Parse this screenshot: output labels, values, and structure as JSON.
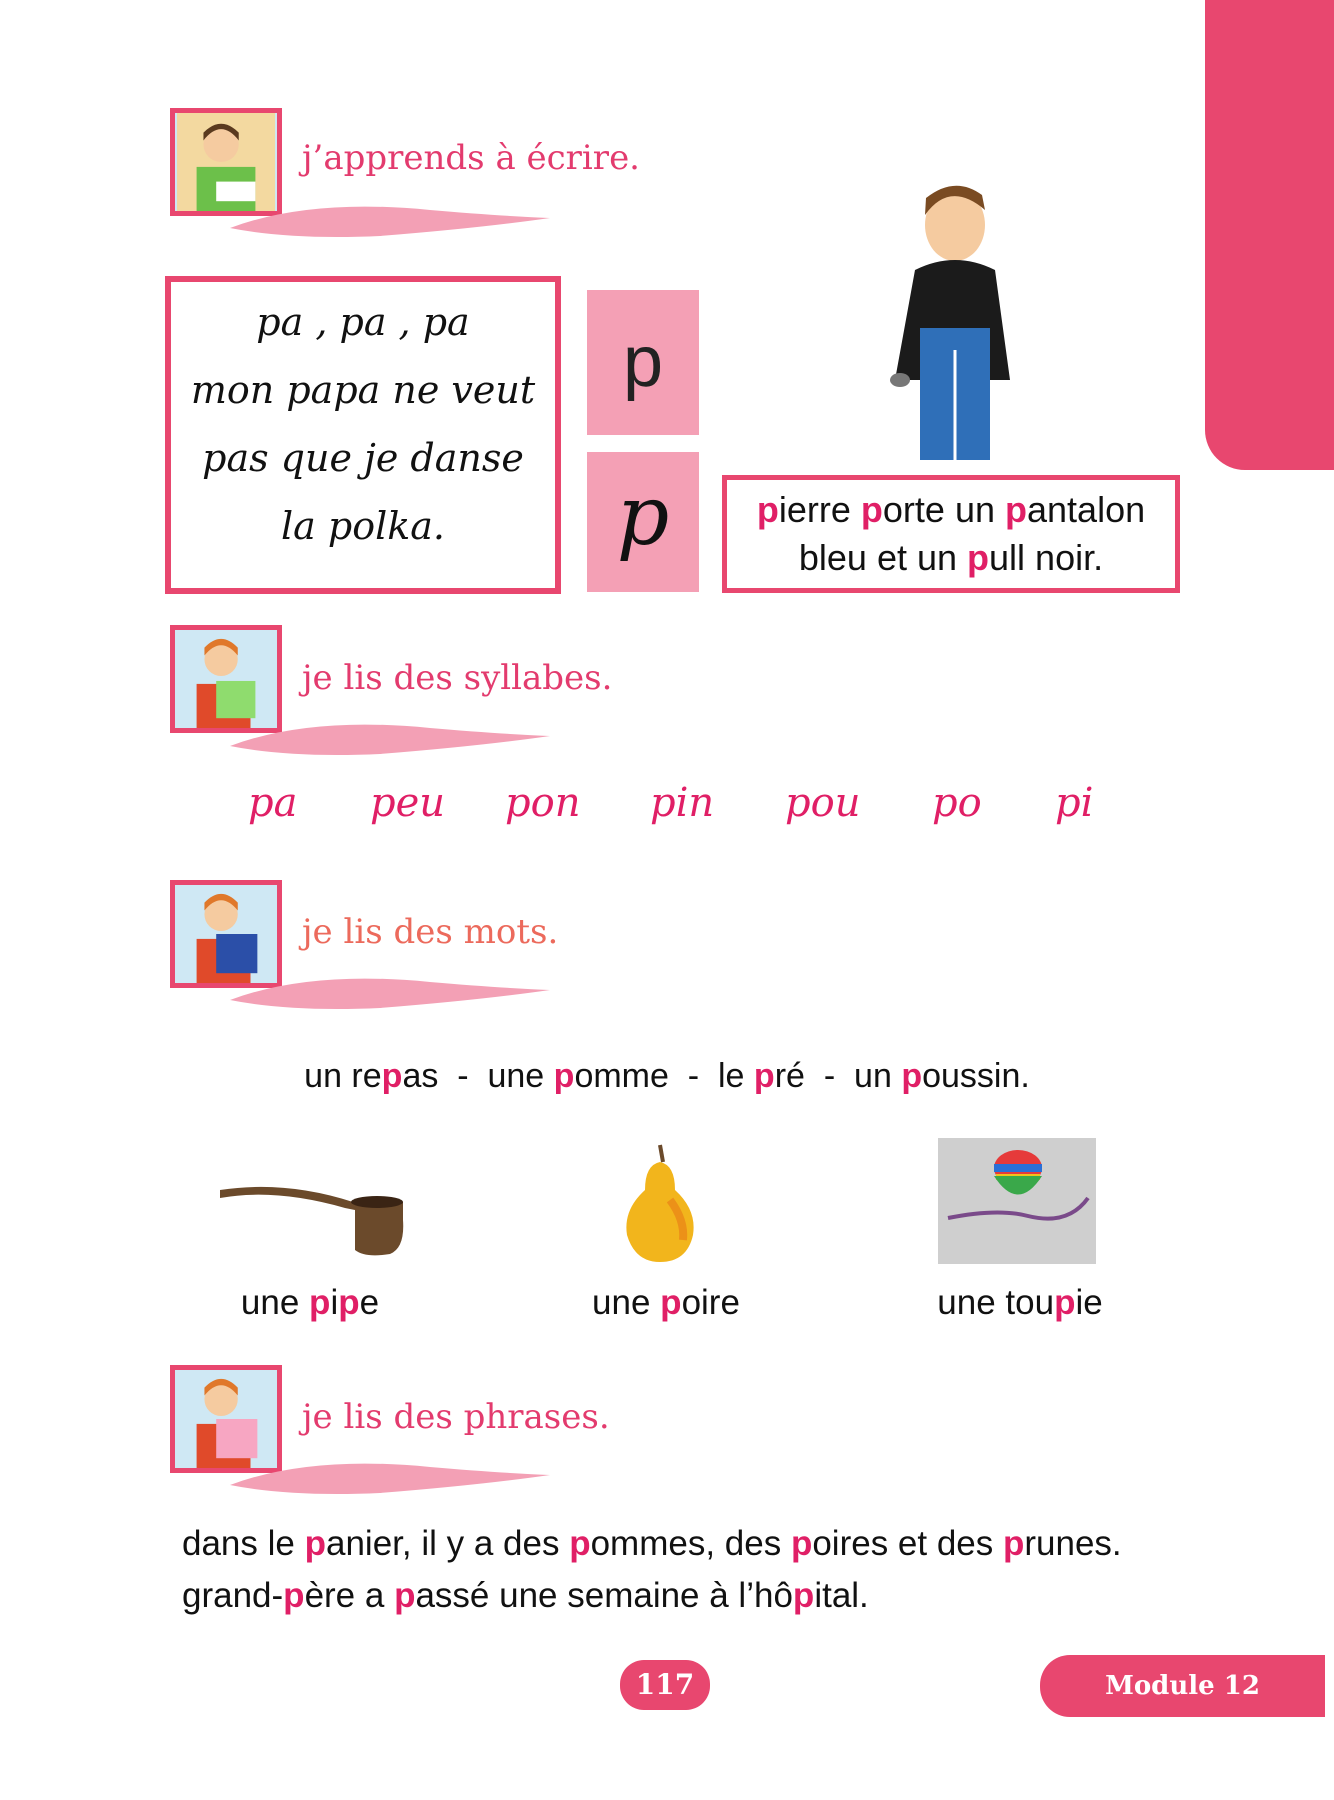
{
  "sections": {
    "writing": {
      "title": "j’apprends à écrire."
    },
    "syllables": {
      "title": "je lis des syllabes."
    },
    "words": {
      "title": "je lis des mots."
    },
    "phrases": {
      "title": "je lis des phrases."
    }
  },
  "cursive_box": {
    "lines": [
      "pa , pa , pa",
      "mon papa ne veut",
      "pas que je danse",
      "la polka."
    ]
  },
  "letter": {
    "print": "p",
    "script": "p"
  },
  "sentence": {
    "line1": [
      {
        "t": "p",
        "hl": true
      },
      {
        "t": "ierre ",
        "hl": false
      },
      {
        "t": "p",
        "hl": true
      },
      {
        "t": "orte un ",
        "hl": false
      },
      {
        "t": "p",
        "hl": true
      },
      {
        "t": "antalon",
        "hl": false
      }
    ],
    "line2": [
      {
        "t": "bleu et un ",
        "hl": false
      },
      {
        "t": "p",
        "hl": true
      },
      {
        "t": "ull noir.",
        "hl": false
      }
    ]
  },
  "syllables": [
    "pa",
    "peu",
    "pon",
    "pin",
    "pou",
    "po",
    "pi"
  ],
  "words_line": [
    {
      "t": "un re",
      "hl": false
    },
    {
      "t": "p",
      "hl": true
    },
    {
      "t": "as  -  une ",
      "hl": false
    },
    {
      "t": "p",
      "hl": true
    },
    {
      "t": "omme  -  le ",
      "hl": false
    },
    {
      "t": "p",
      "hl": true
    },
    {
      "t": "ré  -  un ",
      "hl": false
    },
    {
      "t": "p",
      "hl": true
    },
    {
      "t": "oussin.",
      "hl": false
    }
  ],
  "pictures": [
    {
      "name": "pipe",
      "caption": [
        {
          "t": "une ",
          "hl": false
        },
        {
          "t": "p",
          "hl": true
        },
        {
          "t": "i",
          "hl": false
        },
        {
          "t": "p",
          "hl": true
        },
        {
          "t": "e",
          "hl": false
        }
      ]
    },
    {
      "name": "poire",
      "caption": [
        {
          "t": "une ",
          "hl": false
        },
        {
          "t": "p",
          "hl": true
        },
        {
          "t": "oire",
          "hl": false
        }
      ]
    },
    {
      "name": "toupie",
      "caption": [
        {
          "t": "une tou",
          "hl": false
        },
        {
          "t": "p",
          "hl": true
        },
        {
          "t": "ie",
          "hl": false
        }
      ]
    }
  ],
  "phrases": [
    [
      {
        "t": "dans le ",
        "hl": false
      },
      {
        "t": "p",
        "hl": true
      },
      {
        "t": "anier, il y a des ",
        "hl": false
      },
      {
        "t": "p",
        "hl": true
      },
      {
        "t": "ommes, des ",
        "hl": false
      },
      {
        "t": "p",
        "hl": true
      },
      {
        "t": "oires et des ",
        "hl": false
      },
      {
        "t": "p",
        "hl": true
      },
      {
        "t": "runes.",
        "hl": false
      }
    ],
    [
      {
        "t": "grand-",
        "hl": false
      },
      {
        "t": "p",
        "hl": true
      },
      {
        "t": "ère a ",
        "hl": false
      },
      {
        "t": "p",
        "hl": true
      },
      {
        "t": "assé une semaine à l’hô",
        "hl": false
      },
      {
        "t": "p",
        "hl": true
      },
      {
        "t": "ital.",
        "hl": false
      }
    ]
  ],
  "footer": {
    "page_number": "117",
    "module": "Module 12"
  },
  "colors": {
    "accent": "#e8476f",
    "highlight": "#e01f66",
    "letter_bg": "#f4a0b5"
  }
}
